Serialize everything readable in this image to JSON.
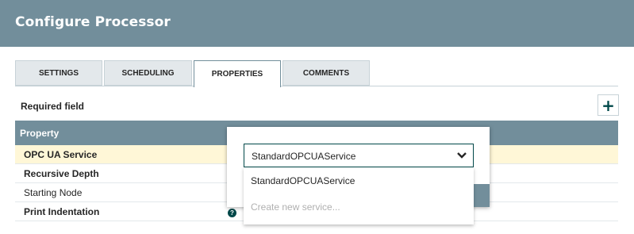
{
  "header": {
    "title": "Configure Processor"
  },
  "tabs": [
    {
      "label": "SETTINGS"
    },
    {
      "label": "SCHEDULING"
    },
    {
      "label": "PROPERTIES"
    },
    {
      "label": "COMMENTS"
    }
  ],
  "active_tab": "PROPERTIES",
  "required_label": "Required field",
  "add_button": "+",
  "grid": {
    "header": "Property",
    "rows": [
      {
        "label": "OPC UA Service"
      },
      {
        "label": "Recursive Depth"
      },
      {
        "label": "Starting Node"
      },
      {
        "label": "Print Indentation"
      }
    ]
  },
  "combo": {
    "selected": "StandardOPCUAService",
    "options": [
      {
        "label": "StandardOPCUAService"
      },
      {
        "label": "Create new service..."
      }
    ]
  },
  "help_icon": "?",
  "colors": {
    "header": "#728e9b",
    "accent": "#004849",
    "selected_row": "#fff7d7"
  }
}
